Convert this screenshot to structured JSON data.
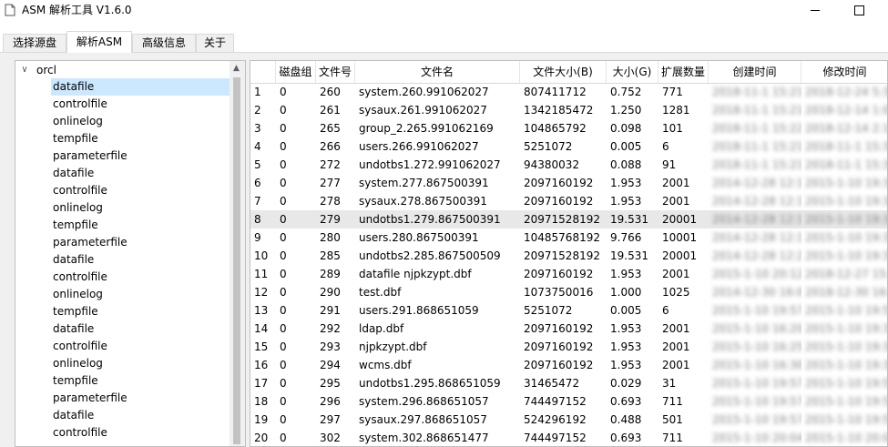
{
  "window": {
    "title": "ASM 解析工具  V1.6.0",
    "app_icon": "document-icon",
    "min_icon": "minimize-icon",
    "max_icon": "maximize-icon"
  },
  "tabs": [
    {
      "label": "选择源盘"
    },
    {
      "label": "解析ASM"
    },
    {
      "label": "高级信息"
    },
    {
      "label": "关于"
    }
  ],
  "tree": {
    "root": "orcl",
    "items": [
      "datafile",
      "controlfile",
      "onlinelog",
      "tempfile",
      "parameterfile",
      "datafile",
      "controlfile",
      "onlinelog",
      "tempfile",
      "parameterfile",
      "datafile",
      "controlfile",
      "onlinelog",
      "tempfile",
      "datafile",
      "controlfile",
      "onlinelog",
      "tempfile",
      "parameterfile",
      "datafile",
      "controlfile"
    ],
    "selected_index": 0
  },
  "table": {
    "columns": [
      "磁盘组",
      "文件号",
      "文件名",
      "文件大小(B)",
      "大小(G)",
      "扩展数量",
      "创建时间",
      "修改时间"
    ],
    "rows": [
      [
        "1",
        "0",
        "260",
        "system.260.991062027",
        "807411712",
        "0.752",
        "771",
        "2018-11-1 15:21:12",
        "2018-12-24 5:30:01"
      ],
      [
        "2",
        "0",
        "261",
        "sysaux.261.991062027",
        "1342185472",
        "1.250",
        "1281",
        "2018-11-1 15:21:12",
        "2018-12-14 1:00:02"
      ],
      [
        "3",
        "0",
        "265",
        "group_2.265.991062169",
        "104865792",
        "0.098",
        "101",
        "2018-11-1 15:22:49",
        "2018-12-14 2:10:05"
      ],
      [
        "4",
        "0",
        "266",
        "users.266.991062027",
        "5251072",
        "0.005",
        "6",
        "2018-11-1 15:21:12",
        "2018-11-1 15:30:00"
      ],
      [
        "5",
        "0",
        "272",
        "undotbs1.272.991062027",
        "94380032",
        "0.088",
        "91",
        "2018-11-1 15:21:12",
        "2018-11-1 15:30:00"
      ],
      [
        "6",
        "0",
        "277",
        "system.277.867500391",
        "2097160192",
        "1.953",
        "2001",
        "2014-12-28 12:19:51",
        "2015-1-10 19:30:12"
      ],
      [
        "7",
        "0",
        "278",
        "sysaux.278.867500391",
        "2097160192",
        "1.953",
        "2001",
        "2014-12-28 12:19:51",
        "2015-1-10 19:30:12"
      ],
      [
        "8",
        "0",
        "279",
        "undotbs1.279.867500391",
        "20971528192",
        "19.531",
        "20001",
        "2014-12-28 12:19:51",
        "2015-1-10 19:30:12"
      ],
      [
        "9",
        "0",
        "280",
        "users.280.867500391",
        "10485768192",
        "9.766",
        "10001",
        "2014-12-28 12:19:51",
        "2015-1-10 19:30:12"
      ],
      [
        "10",
        "0",
        "285",
        "undotbs2.285.867500509",
        "20971528192",
        "19.531",
        "20001",
        "2014-12-28 12:21:49",
        "2015-1-10 19:30:12"
      ],
      [
        "11",
        "0",
        "289",
        "datafile njpkzypt.dbf",
        "2097160192",
        "1.953",
        "2001",
        "2015-1-10 20:12:40",
        "2018-12-27 15:40:02"
      ],
      [
        "12",
        "0",
        "290",
        "test.dbf",
        "1073750016",
        "1.000",
        "1025",
        "2014-12-30 16:09:11",
        "2018-12-30 16:09:11"
      ],
      [
        "13",
        "0",
        "291",
        "users.291.868651059",
        "5251072",
        "0.005",
        "6",
        "2015-1-10 19:57:39",
        "2015-1-10 19:57:39"
      ],
      [
        "14",
        "0",
        "292",
        "ldap.dbf",
        "2097160192",
        "1.953",
        "2001",
        "2015-1-10 16:20:11",
        "2015-1-10 19:30:12"
      ],
      [
        "15",
        "0",
        "293",
        "njpkzypt.dbf",
        "2097160192",
        "1.953",
        "2001",
        "2015-1-10 16:25:40",
        "2015-1-10 19:30:12"
      ],
      [
        "16",
        "0",
        "294",
        "wcms.dbf",
        "2097160192",
        "1.953",
        "2001",
        "2015-1-10 16:30:02",
        "2015-1-10 19:30:12"
      ],
      [
        "17",
        "0",
        "295",
        "undotbs1.295.868651059",
        "31465472",
        "0.029",
        "31",
        "2015-1-10 19:57:39",
        "2015-1-10 19:57:39"
      ],
      [
        "18",
        "0",
        "296",
        "system.296.868651057",
        "744497152",
        "0.693",
        "711",
        "2015-1-10 19:57:37",
        "2015-1-10 19:57:37"
      ],
      [
        "19",
        "0",
        "297",
        "sysaux.297.868651057",
        "524296192",
        "0.488",
        "501",
        "2015-1-10 19:57:37",
        "2015-1-10 19:57:37"
      ],
      [
        "20",
        "0",
        "302",
        "system.302.868651477",
        "744497152",
        "0.693",
        "711",
        "2015-1-10 20:04:37",
        "2015-1-10 20:04:37"
      ]
    ],
    "selected_row": 7
  }
}
